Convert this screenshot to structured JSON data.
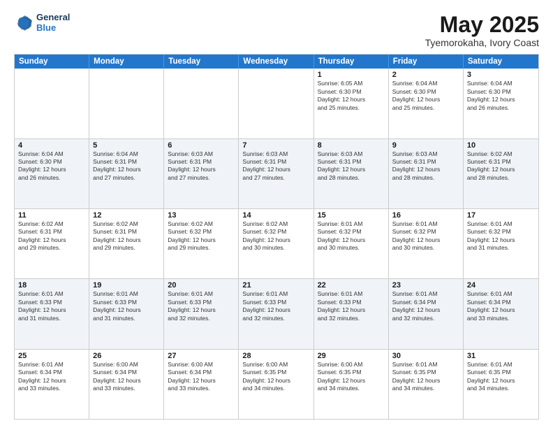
{
  "header": {
    "logo_line1": "General",
    "logo_line2": "Blue",
    "title": "May 2025",
    "subtitle": "Tyemorokaha, Ivory Coast"
  },
  "calendar": {
    "weekdays": [
      "Sunday",
      "Monday",
      "Tuesday",
      "Wednesday",
      "Thursday",
      "Friday",
      "Saturday"
    ],
    "rows": [
      [
        {
          "day": "",
          "info": ""
        },
        {
          "day": "",
          "info": ""
        },
        {
          "day": "",
          "info": ""
        },
        {
          "day": "",
          "info": ""
        },
        {
          "day": "1",
          "info": "Sunrise: 6:05 AM\nSunset: 6:30 PM\nDaylight: 12 hours\nand 25 minutes."
        },
        {
          "day": "2",
          "info": "Sunrise: 6:04 AM\nSunset: 6:30 PM\nDaylight: 12 hours\nand 25 minutes."
        },
        {
          "day": "3",
          "info": "Sunrise: 6:04 AM\nSunset: 6:30 PM\nDaylight: 12 hours\nand 26 minutes."
        }
      ],
      [
        {
          "day": "4",
          "info": "Sunrise: 6:04 AM\nSunset: 6:30 PM\nDaylight: 12 hours\nand 26 minutes."
        },
        {
          "day": "5",
          "info": "Sunrise: 6:04 AM\nSunset: 6:31 PM\nDaylight: 12 hours\nand 27 minutes."
        },
        {
          "day": "6",
          "info": "Sunrise: 6:03 AM\nSunset: 6:31 PM\nDaylight: 12 hours\nand 27 minutes."
        },
        {
          "day": "7",
          "info": "Sunrise: 6:03 AM\nSunset: 6:31 PM\nDaylight: 12 hours\nand 27 minutes."
        },
        {
          "day": "8",
          "info": "Sunrise: 6:03 AM\nSunset: 6:31 PM\nDaylight: 12 hours\nand 28 minutes."
        },
        {
          "day": "9",
          "info": "Sunrise: 6:03 AM\nSunset: 6:31 PM\nDaylight: 12 hours\nand 28 minutes."
        },
        {
          "day": "10",
          "info": "Sunrise: 6:02 AM\nSunset: 6:31 PM\nDaylight: 12 hours\nand 28 minutes."
        }
      ],
      [
        {
          "day": "11",
          "info": "Sunrise: 6:02 AM\nSunset: 6:31 PM\nDaylight: 12 hours\nand 29 minutes."
        },
        {
          "day": "12",
          "info": "Sunrise: 6:02 AM\nSunset: 6:31 PM\nDaylight: 12 hours\nand 29 minutes."
        },
        {
          "day": "13",
          "info": "Sunrise: 6:02 AM\nSunset: 6:32 PM\nDaylight: 12 hours\nand 29 minutes."
        },
        {
          "day": "14",
          "info": "Sunrise: 6:02 AM\nSunset: 6:32 PM\nDaylight: 12 hours\nand 30 minutes."
        },
        {
          "day": "15",
          "info": "Sunrise: 6:01 AM\nSunset: 6:32 PM\nDaylight: 12 hours\nand 30 minutes."
        },
        {
          "day": "16",
          "info": "Sunrise: 6:01 AM\nSunset: 6:32 PM\nDaylight: 12 hours\nand 30 minutes."
        },
        {
          "day": "17",
          "info": "Sunrise: 6:01 AM\nSunset: 6:32 PM\nDaylight: 12 hours\nand 31 minutes."
        }
      ],
      [
        {
          "day": "18",
          "info": "Sunrise: 6:01 AM\nSunset: 6:33 PM\nDaylight: 12 hours\nand 31 minutes."
        },
        {
          "day": "19",
          "info": "Sunrise: 6:01 AM\nSunset: 6:33 PM\nDaylight: 12 hours\nand 31 minutes."
        },
        {
          "day": "20",
          "info": "Sunrise: 6:01 AM\nSunset: 6:33 PM\nDaylight: 12 hours\nand 32 minutes."
        },
        {
          "day": "21",
          "info": "Sunrise: 6:01 AM\nSunset: 6:33 PM\nDaylight: 12 hours\nand 32 minutes."
        },
        {
          "day": "22",
          "info": "Sunrise: 6:01 AM\nSunset: 6:33 PM\nDaylight: 12 hours\nand 32 minutes."
        },
        {
          "day": "23",
          "info": "Sunrise: 6:01 AM\nSunset: 6:34 PM\nDaylight: 12 hours\nand 32 minutes."
        },
        {
          "day": "24",
          "info": "Sunrise: 6:01 AM\nSunset: 6:34 PM\nDaylight: 12 hours\nand 33 minutes."
        }
      ],
      [
        {
          "day": "25",
          "info": "Sunrise: 6:01 AM\nSunset: 6:34 PM\nDaylight: 12 hours\nand 33 minutes."
        },
        {
          "day": "26",
          "info": "Sunrise: 6:00 AM\nSunset: 6:34 PM\nDaylight: 12 hours\nand 33 minutes."
        },
        {
          "day": "27",
          "info": "Sunrise: 6:00 AM\nSunset: 6:34 PM\nDaylight: 12 hours\nand 33 minutes."
        },
        {
          "day": "28",
          "info": "Sunrise: 6:00 AM\nSunset: 6:35 PM\nDaylight: 12 hours\nand 34 minutes."
        },
        {
          "day": "29",
          "info": "Sunrise: 6:00 AM\nSunset: 6:35 PM\nDaylight: 12 hours\nand 34 minutes."
        },
        {
          "day": "30",
          "info": "Sunrise: 6:01 AM\nSunset: 6:35 PM\nDaylight: 12 hours\nand 34 minutes."
        },
        {
          "day": "31",
          "info": "Sunrise: 6:01 AM\nSunset: 6:35 PM\nDaylight: 12 hours\nand 34 minutes."
        }
      ]
    ]
  }
}
